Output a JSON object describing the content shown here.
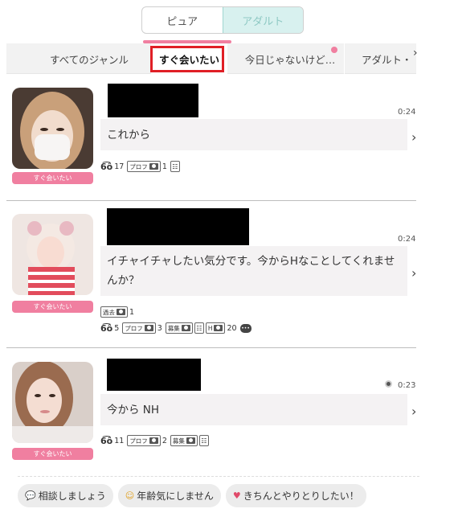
{
  "mode_toggle": {
    "pure": "ピュア",
    "adult": "アダルト"
  },
  "tabs": [
    {
      "label": "すべてのジャンル"
    },
    {
      "label": "すぐ会いたい"
    },
    {
      "label": "今日じゃないけど…"
    },
    {
      "label": "アダルト・"
    }
  ],
  "cards": [
    {
      "badge": "すぐ会いたい",
      "time": "0:24",
      "message": "これから",
      "views": "17",
      "prof_label": "プロフ",
      "prof_count": "1"
    },
    {
      "badge": "すぐ会いたい",
      "time": "0:24",
      "message": "イチャイチャしたい気分です。今からHなことしてくれませんか？",
      "past_label": "過去",
      "past_count": "1",
      "views": "5",
      "prof_label": "プロフ",
      "prof_count": "3",
      "recruit_label": "募集",
      "h_label": "H",
      "h_count": "20"
    },
    {
      "badge": "すぐ会いたい",
      "time": "0:23",
      "message": "今から NH",
      "views": "11",
      "prof_label": "プロフ",
      "prof_count": "2",
      "recruit_label": "募集"
    }
  ],
  "quick_replies": [
    {
      "icon": "speech-bubble-icon",
      "label": "相談しましょう"
    },
    {
      "icon": "smile-face-icon",
      "label": "年齢気にしません"
    },
    {
      "icon": "heart-icon",
      "label": "きちんとやりとりしたい！"
    }
  ]
}
